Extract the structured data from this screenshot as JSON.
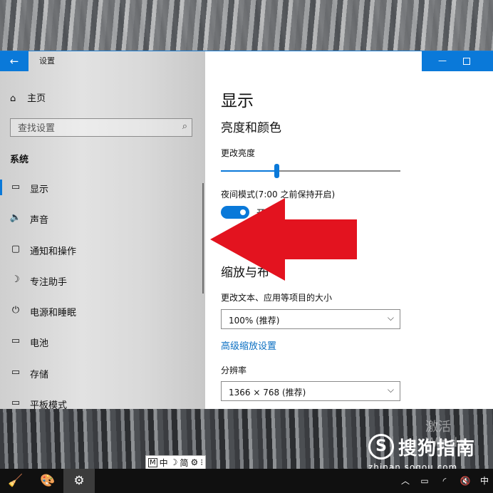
{
  "window": {
    "title": "设置",
    "back_icon": "←",
    "minimize_icon": "—",
    "accent": "#0a79d9"
  },
  "sidebar": {
    "home": {
      "icon": "⌂",
      "label": "主页"
    },
    "search_placeholder": "查找设置",
    "search_icon": "⌕",
    "section": "系统",
    "items": [
      {
        "icon": "▭",
        "label": "显示",
        "active": true
      },
      {
        "icon": "🔈",
        "label": "声音"
      },
      {
        "icon": "▢",
        "label": "通知和操作"
      },
      {
        "icon": "☽",
        "label": "专注助手"
      },
      {
        "icon": "⏻",
        "label": "电源和睡眠"
      },
      {
        "icon": "▭",
        "label": "电池"
      },
      {
        "icon": "▭",
        "label": "存储"
      },
      {
        "icon": "▭",
        "label": "平板模式"
      }
    ]
  },
  "content": {
    "title": "显示",
    "brightness_header": "亮度和颜色",
    "brightness_label": "更改亮度",
    "brightness_value": 0.31,
    "night_mode_label": "夜间模式(7:00 之前保持开启)",
    "night_mode_state": "开",
    "scale_header": "缩放与布",
    "scale_label": "更改文本、应用等项目的大小",
    "scale_value": "100% (推荐)",
    "advanced_link": "高级缩放设置",
    "resolution_label": "分辨率",
    "resolution_value": "1366 × 768 (推荐)",
    "chevron": "⌵"
  },
  "watermark": {
    "activate": "激活 Windo",
    "logo_letter": "S",
    "logo_text": "搜狗指南",
    "url": "zhinan.sogou.com"
  },
  "ime": {
    "mode": "M",
    "lang": "中",
    "moon": "☽",
    "simp": "简",
    "gear": "⚙",
    "more": "⁝"
  },
  "taskbar": {
    "apps": [
      "🧹",
      "🎨",
      "⚙"
    ],
    "tray": {
      "up": "︿",
      "battery": "▭",
      "wifi": "◜",
      "volume": "🔇",
      "lang": "中"
    }
  }
}
